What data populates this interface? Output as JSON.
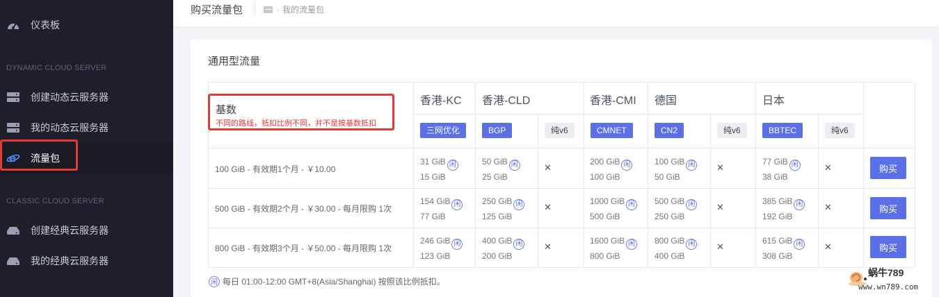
{
  "sidebar": {
    "dashboard": "仪表板",
    "section_dynamic": "DYNAMIC CLOUD SERVER",
    "create_dynamic": "创建动态云服务器",
    "my_dynamic": "我的动态云服务器",
    "traffic_pack": "流量包",
    "section_classic": "CLASSIC CLOUD SERVER",
    "create_classic": "创建经典云服务器",
    "my_classic": "我的经典云服务器"
  },
  "topbar": {
    "title": "购买流量包",
    "breadcrumb": "我的流量包"
  },
  "card": {
    "title": "通用型流量",
    "basis_title": "基数",
    "basis_note": "不同的路线，抵扣比例不同，并不是按基数抵扣",
    "regions": [
      "香港-KC",
      "香港-CLD",
      "香港-CMI",
      "德国",
      "日本"
    ],
    "tags": [
      "三网优化",
      "BGP",
      "纯v6",
      "CMNET",
      "CN2",
      "纯v6",
      "BBTEC",
      "纯v6"
    ],
    "xian_glyph": "闲",
    "x_glyph": "✕",
    "buy_label": "购买",
    "rows": [
      {
        "label": "100 GiB - 有效期1个月 - ￥10.00",
        "kc": [
          "31 GiB",
          "15 GiB"
        ],
        "cld_bgp": [
          "50 GiB",
          "25 GiB"
        ],
        "cmi": [
          "200 GiB",
          "100 GiB"
        ],
        "de_cn2": [
          "100 GiB",
          "50 GiB"
        ],
        "jp_bbtec": [
          "77 GiB",
          "38 GiB"
        ]
      },
      {
        "label": "500 GiB - 有效期2个月 - ￥30.00 - 每月限购 1次",
        "kc": [
          "154 GiB",
          "77 GiB"
        ],
        "cld_bgp": [
          "250 GiB",
          "125 GiB"
        ],
        "cmi": [
          "1000 GiB",
          "500 GiB"
        ],
        "de_cn2": [
          "500 GiB",
          "250 GiB"
        ],
        "jp_bbtec": [
          "385 GiB",
          "192 GiB"
        ]
      },
      {
        "label": "800 GiB - 有效期3个月 - ￥50.00 - 每月限购 1次",
        "kc": [
          "246 GiB",
          "123 GiB"
        ],
        "cld_bgp": [
          "400 GiB",
          "200 GiB"
        ],
        "cmi": [
          "1600 GiB",
          "800 GiB"
        ],
        "de_cn2": [
          "800 GiB",
          "400 GiB"
        ],
        "jp_bbtec": [
          "615 GiB",
          "308 GiB"
        ]
      }
    ],
    "footnote": "每日 01:00-12:00 GMT+8(Asia/Shanghai) 按照该比例抵扣。"
  },
  "watermark": {
    "title": "蜗牛789",
    "url": "www.wn789.com"
  },
  "colors": {
    "sidebar_bg": "#1e1f2b",
    "accent": "#5b70e6",
    "highlight_red": "#e53935"
  }
}
